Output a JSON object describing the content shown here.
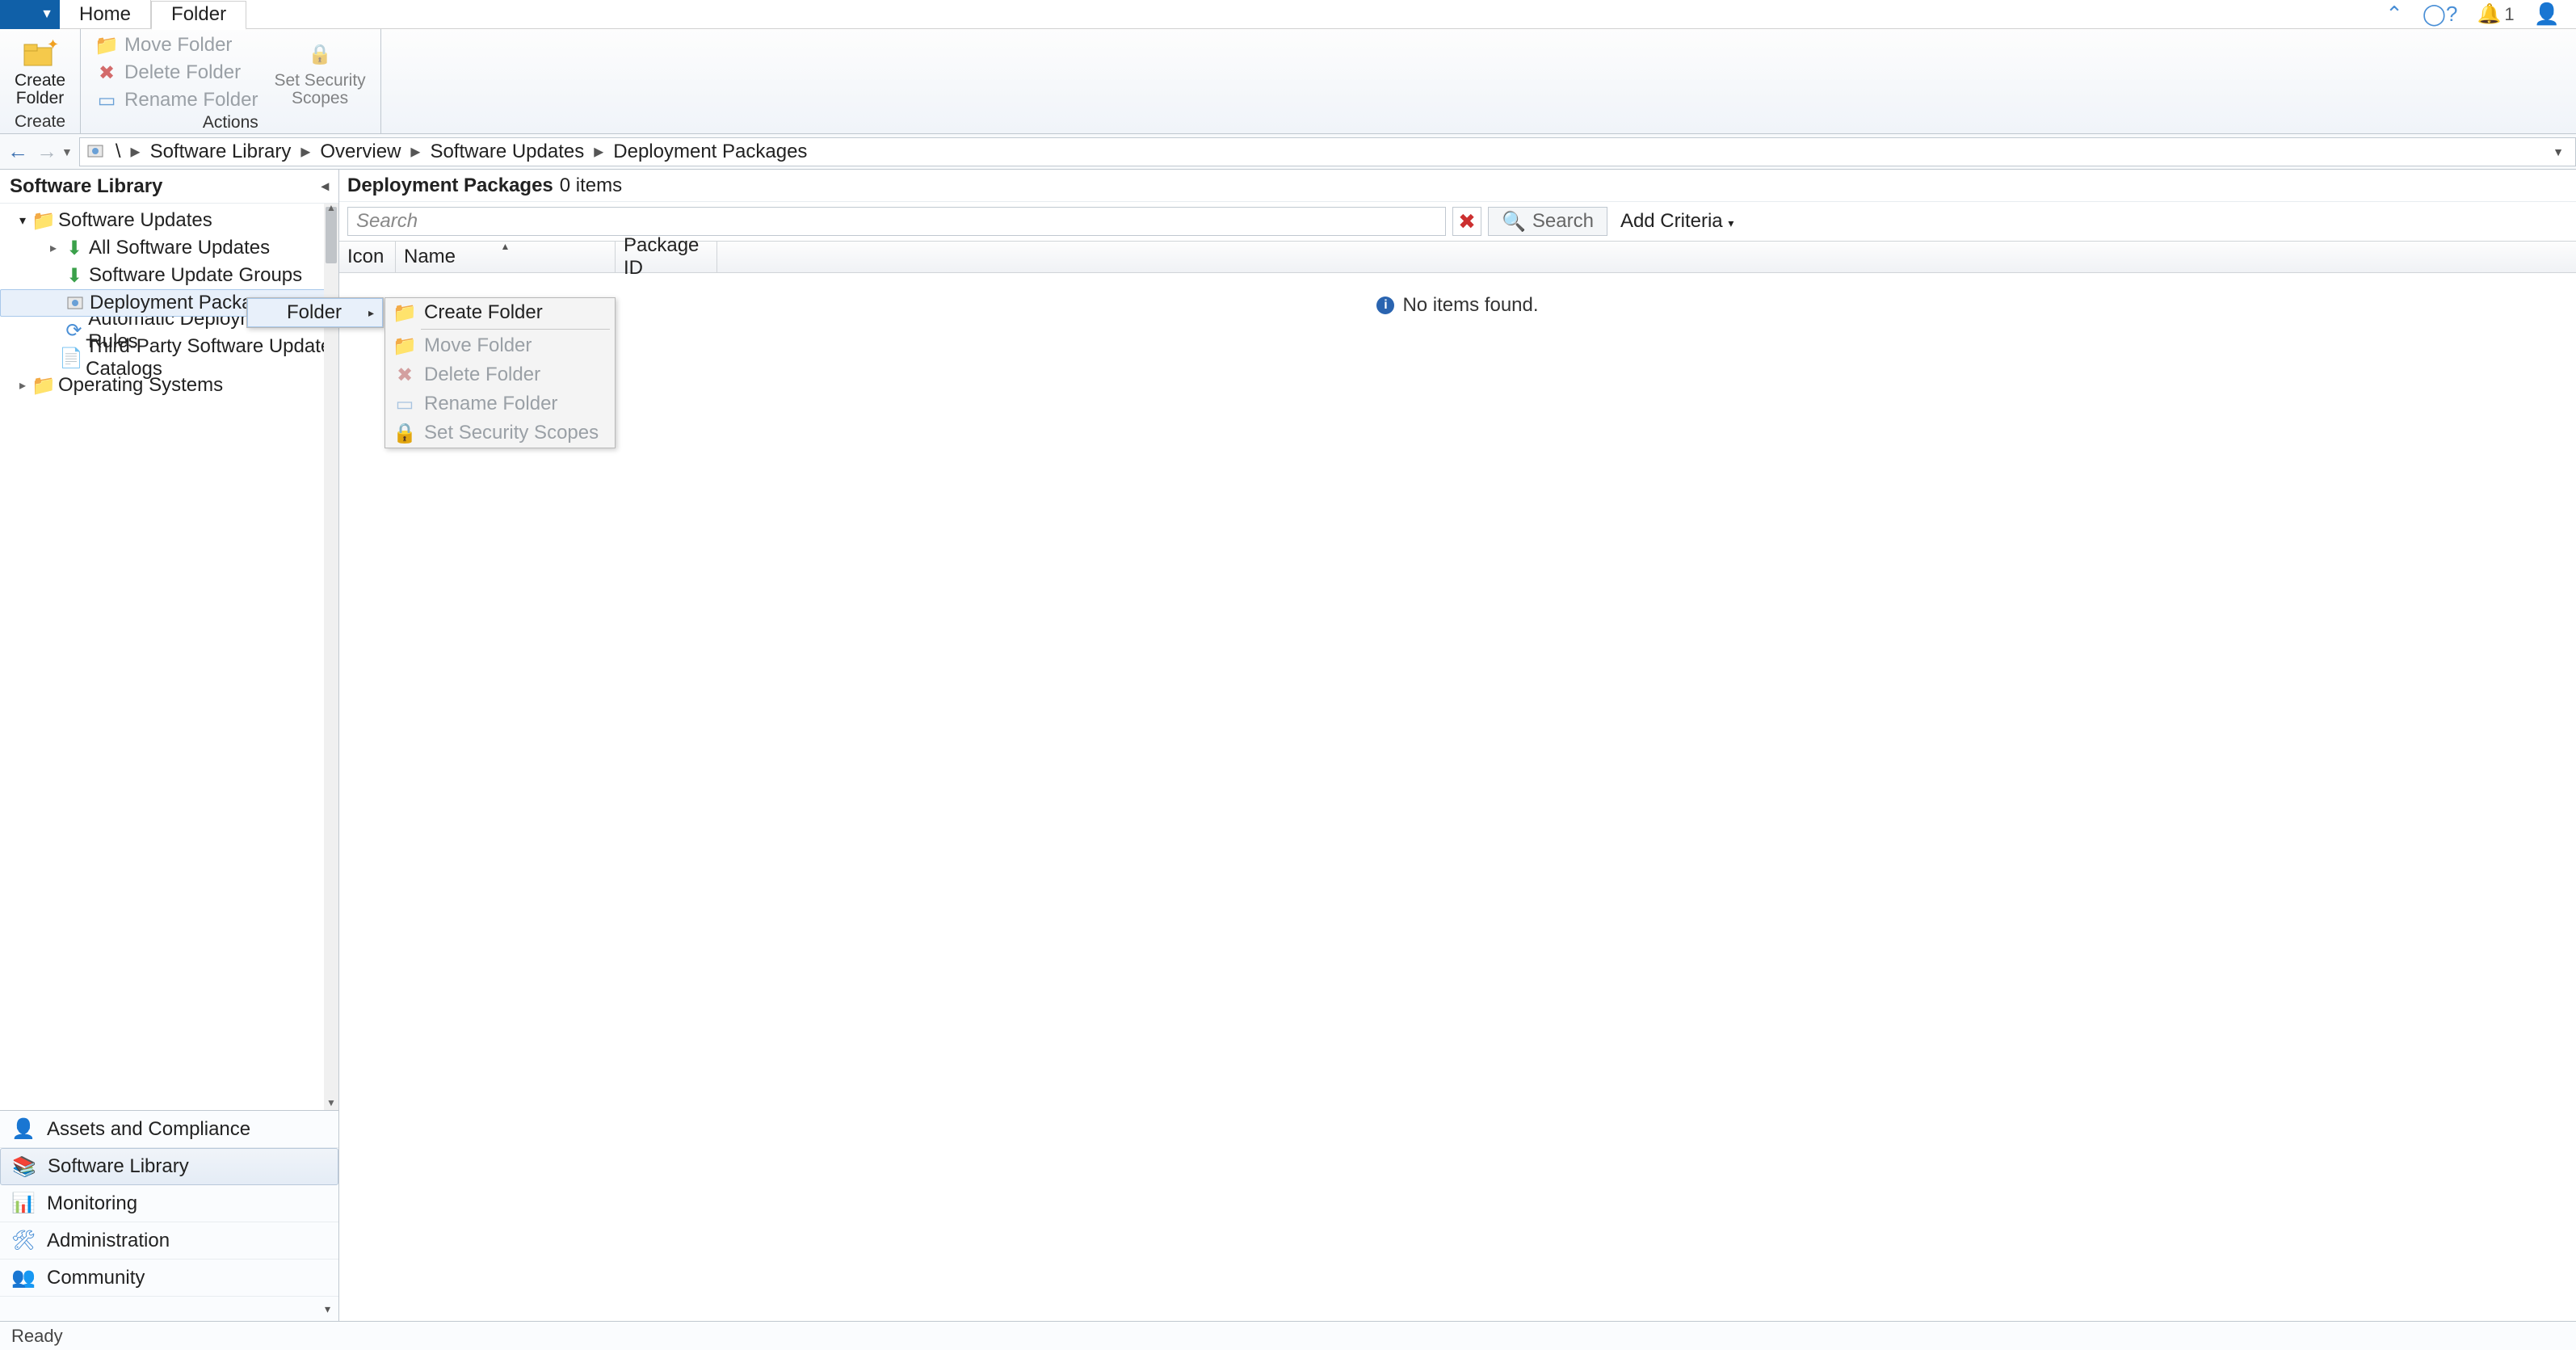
{
  "tabs": {
    "home": "Home",
    "folder": "Folder",
    "active": "Folder"
  },
  "header_icons": {
    "bell_count": "1"
  },
  "ribbon": {
    "create_folder": "Create\nFolder",
    "create_label": "Create",
    "move_folder": "Move Folder",
    "delete_folder": "Delete Folder",
    "rename_folder": "Rename Folder",
    "set_security": "Set Security\nScopes",
    "actions_label": "Actions"
  },
  "breadcrumb": {
    "root": "\\",
    "items": [
      "Software Library",
      "Overview",
      "Software Updates",
      "Deployment Packages"
    ]
  },
  "sidebar": {
    "title": "Software Library",
    "tree": {
      "sw_updates": "Software Updates",
      "all_sw_updates": "All Software Updates",
      "sw_update_groups": "Software Update Groups",
      "deployment_packages": "Deployment Packages",
      "adr": "Automatic Deployment Rules",
      "third_party": "Third-Party Software Update Catalogs",
      "os": "Operating Systems"
    },
    "nav": {
      "assets": "Assets and Compliance",
      "library": "Software Library",
      "monitoring": "Monitoring",
      "administration": "Administration",
      "community": "Community"
    }
  },
  "main": {
    "title": "Deployment Packages",
    "count_label": "0 items",
    "search_placeholder": "Search",
    "search_button": "Search",
    "add_criteria": "Add Criteria",
    "cols": {
      "icon": "Icon",
      "name": "Name",
      "package_id": "Package ID"
    },
    "empty": "No items found."
  },
  "context": {
    "folder": "Folder",
    "create_folder": "Create Folder",
    "move_folder": "Move Folder",
    "delete_folder": "Delete Folder",
    "rename_folder": "Rename Folder",
    "set_security": "Set Security Scopes"
  },
  "status": {
    "ready": "Ready"
  }
}
